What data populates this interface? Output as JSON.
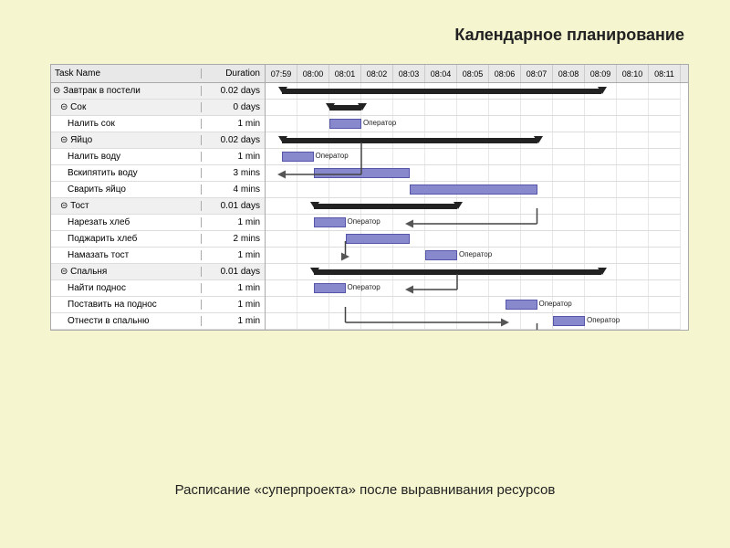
{
  "title": "Календарное планирование",
  "caption": "Расписание «суперпроекта» после выравнивания ресурсов",
  "table": {
    "headers": [
      "Task Name",
      "Duration"
    ],
    "rows": [
      {
        "name": "Завтрак в постели",
        "duration": "0.02 days",
        "level": 0,
        "group": true
      },
      {
        "name": "Сок",
        "duration": "0 days",
        "level": 1,
        "group": true
      },
      {
        "name": "Налить сок",
        "duration": "1 min",
        "level": 2,
        "group": false
      },
      {
        "name": "Яйцо",
        "duration": "0.02 days",
        "level": 1,
        "group": true
      },
      {
        "name": "Налить воду",
        "duration": "1 min",
        "level": 2,
        "group": false
      },
      {
        "name": "Вскипятить воду",
        "duration": "3 mins",
        "level": 2,
        "group": false
      },
      {
        "name": "Сварить яйцо",
        "duration": "4 mins",
        "level": 2,
        "group": false
      },
      {
        "name": "Тост",
        "duration": "0.01 days",
        "level": 1,
        "group": true
      },
      {
        "name": "Нарезать хлеб",
        "duration": "1 min",
        "level": 2,
        "group": false
      },
      {
        "name": "Поджарить хлеб",
        "duration": "2 mins",
        "level": 2,
        "group": false
      },
      {
        "name": "Намазать тост",
        "duration": "1 min",
        "level": 2,
        "group": false
      },
      {
        "name": "Спальня",
        "duration": "0.01 days",
        "level": 1,
        "group": true
      },
      {
        "name": "Найти поднос",
        "duration": "1 min",
        "level": 2,
        "group": false
      },
      {
        "name": "Поставить на поднос",
        "duration": "1 min",
        "level": 2,
        "group": false
      },
      {
        "name": "Отнести в спальню",
        "duration": "1 min",
        "level": 2,
        "group": false
      }
    ]
  },
  "timeline": {
    "labels": [
      "07:59",
      "08:00",
      "08:01",
      "08:02",
      "08:03",
      "08:04",
      "08:05",
      "08:06",
      "08:07",
      "08:08",
      "08:09",
      "08:10",
      "08:11"
    ]
  }
}
